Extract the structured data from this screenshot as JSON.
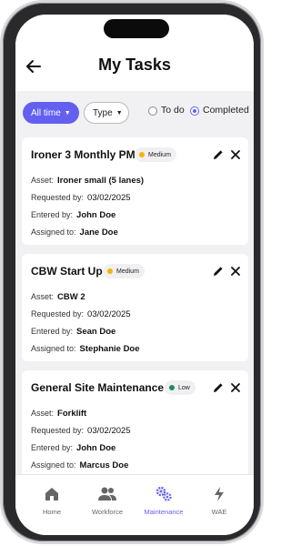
{
  "header": {
    "title": "My Tasks"
  },
  "filters": {
    "time_label": "All time",
    "type_label": "Type",
    "todo_label": "To do",
    "completed_label": "Completed",
    "selected": "Completed"
  },
  "field_labels": {
    "asset": "Asset:",
    "requested_by": "Requested by:",
    "entered_by": "Entered by:",
    "assigned_to": "Assigned to:"
  },
  "tasks": [
    {
      "title": "Ironer 3 Monthly PM",
      "priority": "Medium",
      "priority_color": "#f5b400",
      "asset": "Ironer small (5 lanes)",
      "requested_by": "03/02/2025",
      "entered_by": "John Doe",
      "assigned_to": "Jane Doe"
    },
    {
      "title": "CBW Start Up",
      "priority": "Medium",
      "priority_color": "#f5b400",
      "asset": "CBW 2",
      "requested_by": "03/02/2025",
      "entered_by": "Sean Doe",
      "assigned_to": "Stephanie Doe"
    },
    {
      "title": "General Site Maintenance",
      "priority": "Low",
      "priority_color": "#1f8a6a",
      "asset": "Forklift",
      "requested_by": "03/02/2025",
      "entered_by": "John Doe",
      "assigned_to": "Marcus Doe"
    }
  ],
  "nav": {
    "active": "Maintenance",
    "active_color": "#6360f0",
    "items": [
      {
        "label": "Home",
        "icon": "home-icon"
      },
      {
        "label": "Workforce",
        "icon": "people-icon"
      },
      {
        "label": "Maintenance",
        "icon": "gears-icon"
      },
      {
        "label": "WAE",
        "icon": "lightning-icon"
      }
    ]
  }
}
